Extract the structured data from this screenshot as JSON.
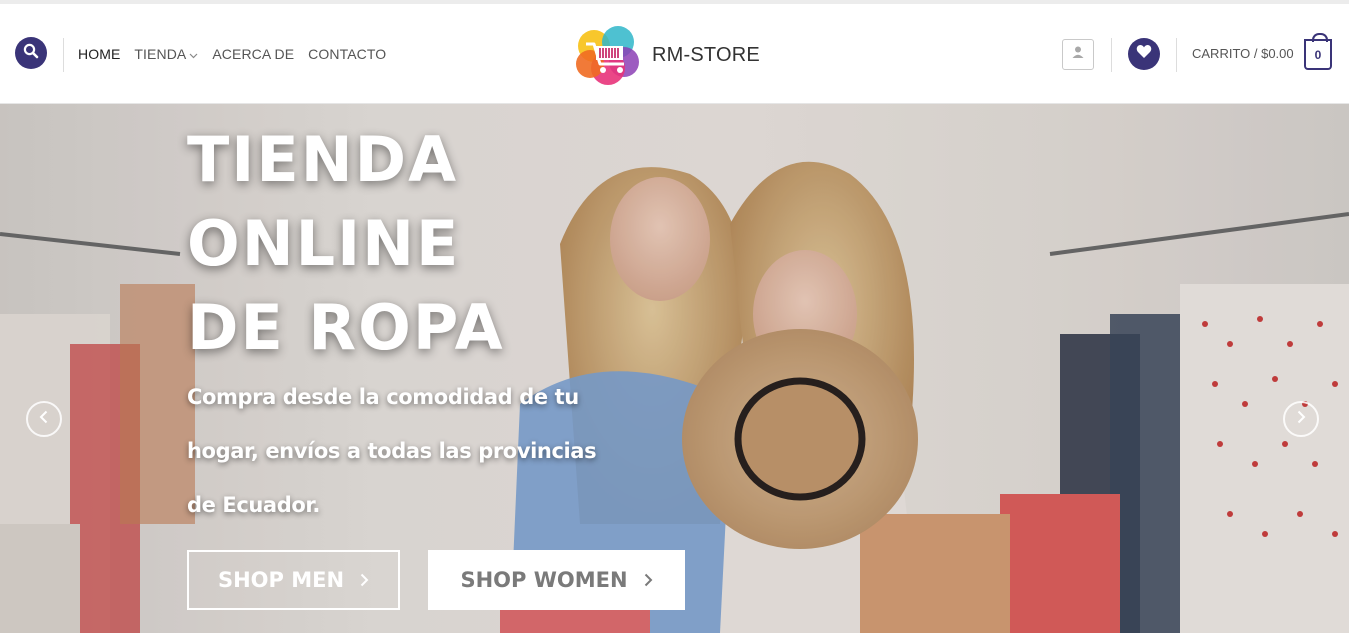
{
  "header": {
    "nav": [
      {
        "label": "HOME",
        "active": true,
        "has_dropdown": false
      },
      {
        "label": "TIENDA",
        "active": false,
        "has_dropdown": true
      },
      {
        "label": "ACERCA DE",
        "active": false,
        "has_dropdown": false
      },
      {
        "label": "CONTACTO",
        "active": false,
        "has_dropdown": false
      }
    ],
    "logo_text": "RM-STORE",
    "cart_label": "CARRITO / $0.00",
    "cart_count": "0",
    "icons": {
      "search": "search-icon",
      "account": "user-icon",
      "wishlist": "heart-icon",
      "cart": "cart-bag-icon"
    }
  },
  "hero": {
    "title_lines": [
      "TIENDA",
      "ONLINE",
      "DE ROPA"
    ],
    "subtitle_lines": [
      "Compra desde la comodidad de tu",
      "hogar, envíos a todas las provincias",
      "de Ecuador."
    ],
    "buttons": [
      {
        "label": "SHOP MEN",
        "style": "outline"
      },
      {
        "label": "SHOP WOMEN",
        "style": "solid"
      }
    ],
    "prev_arrow_icon": "chevron-left-icon",
    "next_arrow_icon": "chevron-right-icon"
  },
  "colors": {
    "primary": "#3a3478",
    "nav_text": "#555555",
    "button_women_text": "#7a7a7a"
  }
}
